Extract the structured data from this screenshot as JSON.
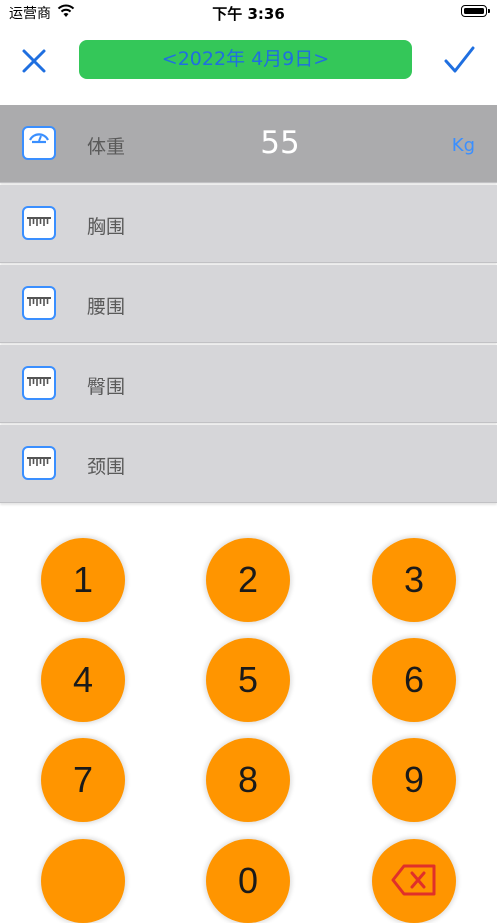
{
  "status_bar": {
    "carrier": "运营商",
    "time": "下午 3:36"
  },
  "nav": {
    "date_label": "<2022年 4月9日>",
    "accent": "#3a8fff",
    "pill_color": "#34c759"
  },
  "measurements": [
    {
      "label": "体重",
      "value": "55",
      "unit": "Kg",
      "selected": true,
      "icon": "scale-icon"
    },
    {
      "label": "胸围",
      "selected": false,
      "icon": "ruler-icon"
    },
    {
      "label": "腰围",
      "selected": false,
      "icon": "ruler-icon"
    },
    {
      "label": "臀围",
      "selected": false,
      "icon": "ruler-icon"
    },
    {
      "label": "颈围",
      "selected": false,
      "icon": "ruler-icon"
    }
  ],
  "keypad": {
    "keys": [
      "1",
      "2",
      "3",
      "4",
      "5",
      "6",
      "7",
      "8",
      "9",
      "",
      "0"
    ],
    "delete_icon": "backspace-icon",
    "key_color": "#ff9500"
  }
}
